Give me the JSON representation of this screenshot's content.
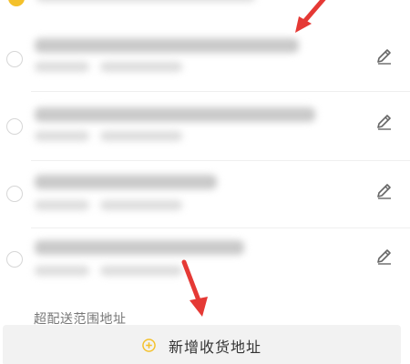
{
  "address_list": {
    "items": [
      {
        "selected": false
      },
      {
        "selected": false
      },
      {
        "selected": false
      },
      {
        "selected": false
      }
    ],
    "edit_icon": "pencil-icon",
    "radio_icon": "radio-circle"
  },
  "out_of_range": {
    "label": "超配送范围地址"
  },
  "add_address": {
    "label": "新增收货地址",
    "icon": "plus-circle-icon"
  },
  "colors": {
    "accent": "#f4c12b",
    "annotation_arrow": "#e53935"
  }
}
